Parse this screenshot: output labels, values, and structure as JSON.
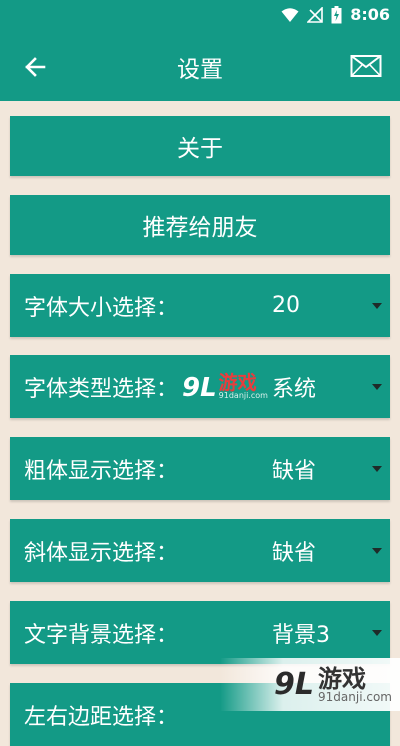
{
  "statusbar": {
    "time": "8:06"
  },
  "appbar": {
    "title": "设置",
    "back_icon": "back-arrow-icon",
    "mail_icon": "mail-icon"
  },
  "buttons": {
    "about": "关于",
    "recommend": "推荐给朋友"
  },
  "settings": [
    {
      "label": "字体大小选择：",
      "value": "20"
    },
    {
      "label": "字体类型选择：",
      "value": "系统"
    },
    {
      "label": "粗体显示选择：",
      "value": "缺省"
    },
    {
      "label": "斜体显示选择：",
      "value": "缺省"
    },
    {
      "label": "文字背景选择：",
      "value": "背景3"
    },
    {
      "label": "左右边距选择：",
      "value": ""
    }
  ],
  "watermark": {
    "center_num": "9L",
    "center_text": "游戏",
    "center_url": "91danji.com",
    "corner_num": "9L",
    "corner_text": "游戏",
    "corner_url": "91danji.com"
  },
  "colors": {
    "primary": "#139a86",
    "background": "#f2e7db"
  }
}
